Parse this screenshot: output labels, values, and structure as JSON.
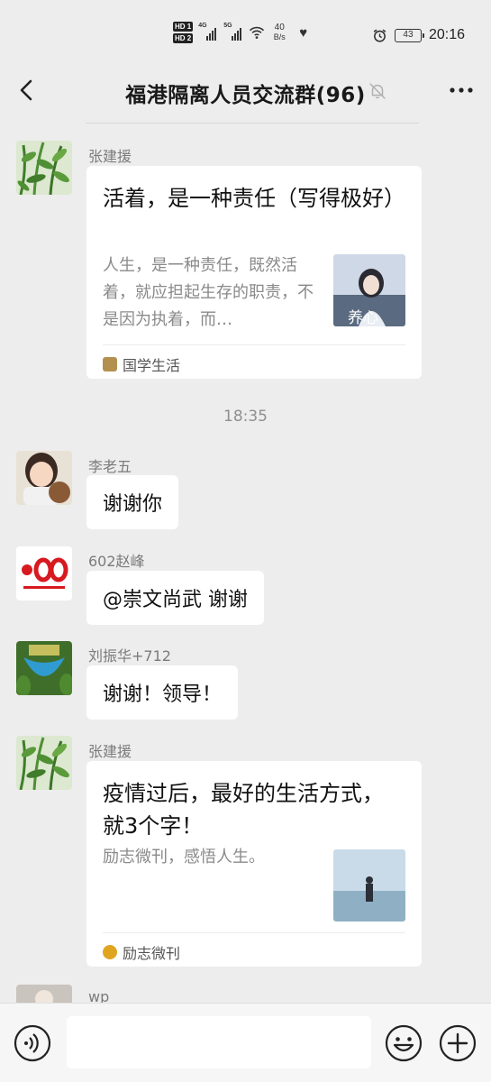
{
  "status_bar": {
    "hd1": "HD 1",
    "hd2": "HD 2",
    "sig1_label": "4G",
    "sig2_label": "5G",
    "net_speed_value": "40",
    "net_speed_unit": "B/s",
    "battery": "43",
    "time": "20:16"
  },
  "header": {
    "title": "福港隔离人员交流群(96)"
  },
  "messages": [
    {
      "sender": "张建援",
      "type": "card",
      "title": "活着，是一种责任（写得极好）",
      "desc": "人生，是一种责任，既然活着，就应担起生存的职责，不是因为执着，而…",
      "thumb_text": "养心",
      "source": "国学生活"
    },
    {
      "sender": "李老五",
      "type": "text",
      "text": "谢谢你"
    },
    {
      "sender": "602赵峰",
      "type": "text",
      "text": "@崇文尚武  谢谢",
      "avatar_text": "100"
    },
    {
      "sender": "刘振华+712",
      "type": "text",
      "text": "谢谢！领导！"
    },
    {
      "sender": "张建援",
      "type": "card",
      "title": "疫情过后，最好的生活方式，就3个字！",
      "desc": "励志微刊，感悟人生。",
      "source": "励志微刊"
    },
    {
      "sender": "wp",
      "type": "partial"
    }
  ],
  "timestamp": "18:35",
  "input": {
    "value": ""
  },
  "colors": {
    "background": "#ededed",
    "bubble": "#ffffff",
    "sender_name": "#7b7b7b",
    "timestamp": "#8f8f8f"
  }
}
